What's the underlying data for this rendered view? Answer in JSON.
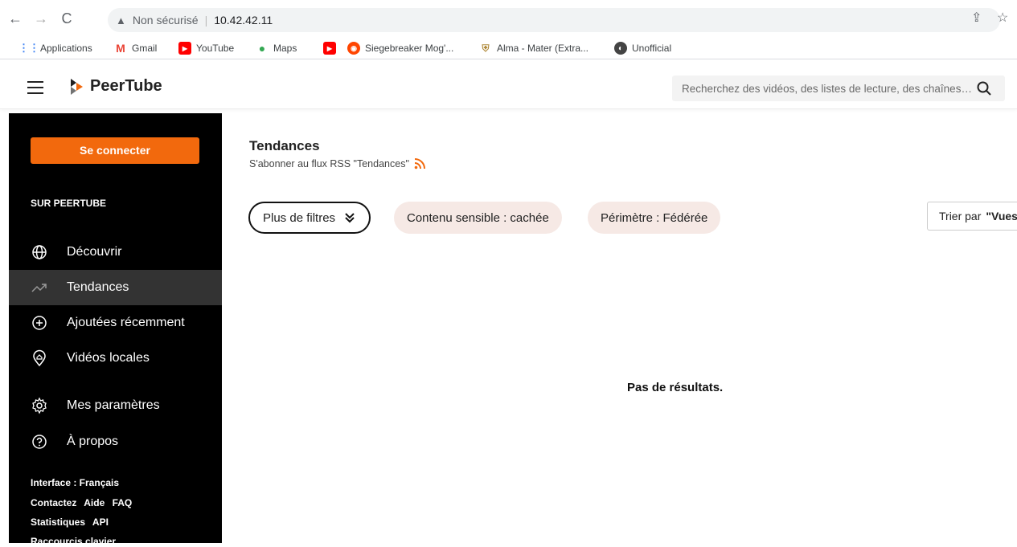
{
  "browser": {
    "security_label": "Non sécurisé",
    "url": "10.42.42.11",
    "bookmarks": [
      {
        "label": "Applications",
        "icon": "apps-grid-icon"
      },
      {
        "label": "Gmail",
        "icon": "gmail-icon"
      },
      {
        "label": "YouTube",
        "icon": "youtube-icon"
      },
      {
        "label": "Maps",
        "icon": "maps-icon"
      },
      {
        "label": "",
        "icon": "youtube-icon"
      },
      {
        "label": "Siegebreaker Mog'...",
        "icon": "reddit-icon"
      },
      {
        "label": "Alma - Mater (Extra...",
        "icon": "shield-icon"
      },
      {
        "label": "Unofficial",
        "icon": "globe-icon"
      }
    ]
  },
  "header": {
    "app_name": "PeerTube",
    "search_placeholder": "Recherchez des vidéos, des listes de lecture, des chaînes…"
  },
  "sidebar": {
    "login_label": "Se connecter",
    "section_title": "SUR PEERTUBE",
    "items": [
      {
        "label": "Découvrir",
        "icon": "globe-icon"
      },
      {
        "label": "Tendances",
        "icon": "trending-icon",
        "active": true
      },
      {
        "label": "Ajoutées récemment",
        "icon": "plus-circle-icon"
      },
      {
        "label": "Vidéos locales",
        "icon": "home-pin-icon"
      },
      {
        "label": "Mes paramètres",
        "icon": "gear-icon"
      },
      {
        "label": "À propos",
        "icon": "help-circle-icon"
      }
    ],
    "footer": {
      "interface": "Interface : Français",
      "contact": "Contactez",
      "help": "Aide",
      "faq": "FAQ",
      "stats": "Statistiques",
      "api": "API",
      "shortcuts": "Raccourcis clavier"
    }
  },
  "main": {
    "title": "Tendances",
    "rss_text": "S'abonner au flux RSS \"Tendances\"",
    "filters": {
      "more": "Plus de filtres",
      "sensitive": "Contenu sensible : cachée",
      "scope": "Périmètre : Fédérée"
    },
    "sort_prefix": "Trier par",
    "sort_value": "\"Vues\"",
    "empty_message": "Pas de résultats."
  },
  "colors": {
    "accent": "#f2690d",
    "sidebar_bg": "#000000",
    "pill_soft": "#f6e9e5"
  }
}
